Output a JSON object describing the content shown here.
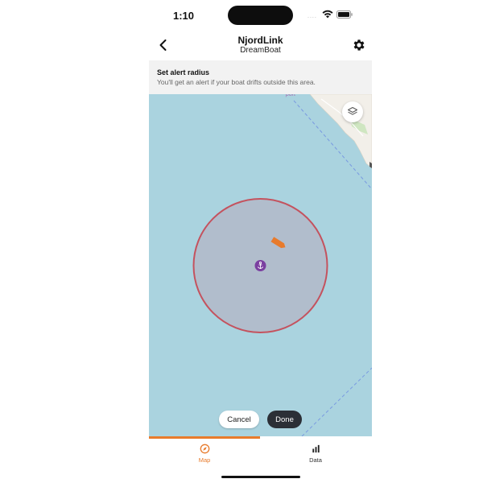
{
  "status_bar": {
    "time": "1:10",
    "signal": "....",
    "icons": [
      "wifi-icon",
      "battery-icon"
    ]
  },
  "header": {
    "title": "NjordLink",
    "subtitle": "DreamBoat",
    "back_icon": "chevron-left-icon",
    "settings_icon": "gear-icon"
  },
  "alert_info": {
    "title": "Set alert radius",
    "description": "You'll get an alert if your boat drifts outside this area."
  },
  "map": {
    "partial_label": "port",
    "layers_icon": "layers-icon",
    "anchor_icon": "anchor-icon",
    "boat_icon": "boat-icon",
    "colors": {
      "water": "#aad3df",
      "land": "#f2efe9",
      "radius_fill": "#b3b5c6",
      "radius_stroke": "#c4525e",
      "anchor": "#7b3fa0",
      "boat": "#e87b2c",
      "route_dash": "#7a9be0"
    }
  },
  "actions": {
    "cancel_label": "Cancel",
    "done_label": "Done"
  },
  "tabs": [
    {
      "label": "Map",
      "icon": "compass-icon",
      "active": true
    },
    {
      "label": "Data",
      "icon": "bar-chart-icon",
      "active": false
    }
  ],
  "accent_color": "#e87b2c"
}
